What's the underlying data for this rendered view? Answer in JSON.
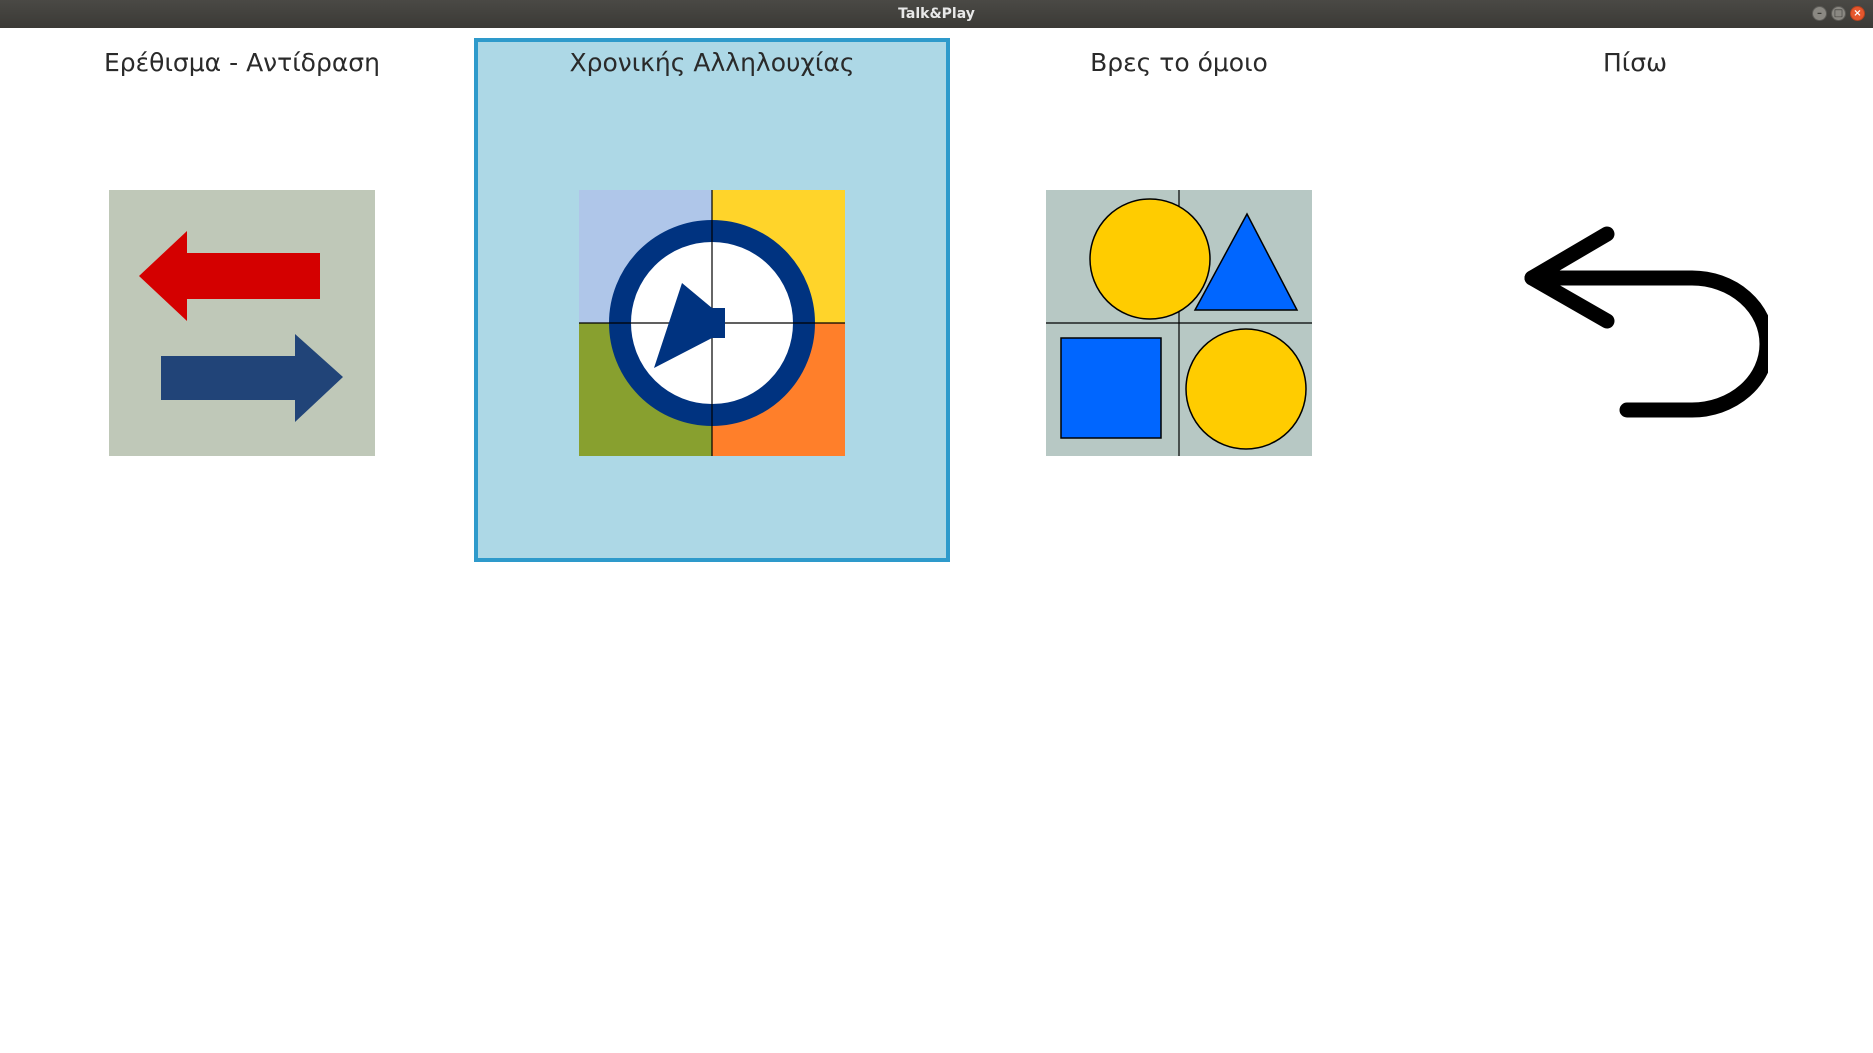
{
  "window": {
    "title": "Talk&Play",
    "controls": [
      "minimize-icon",
      "maximize-icon",
      "close-icon"
    ]
  },
  "menu": {
    "items": [
      {
        "id": "stimulus",
        "label": "Ερέθισμα - Αντίδραση",
        "icon": "arrows-left-right-icon",
        "selected": false
      },
      {
        "id": "sequence",
        "label": "Χρονικής Αλληλουχίας",
        "icon": "clock-icon",
        "selected": true
      },
      {
        "id": "match",
        "label": "Βρες το όμοιο",
        "icon": "shapes-grid-icon",
        "selected": false
      },
      {
        "id": "back",
        "label": "Πίσω",
        "icon": "back-arrow-icon",
        "selected": false
      }
    ]
  },
  "colors": {
    "selected_bg": "#add8e6",
    "selected_border": "#2e9acb",
    "arrow_red": "#d40000",
    "arrow_blue": "#214478",
    "clock_blue": "#003380",
    "shape_yellow": "#ffcc00",
    "shape_blue": "#0066ff"
  }
}
